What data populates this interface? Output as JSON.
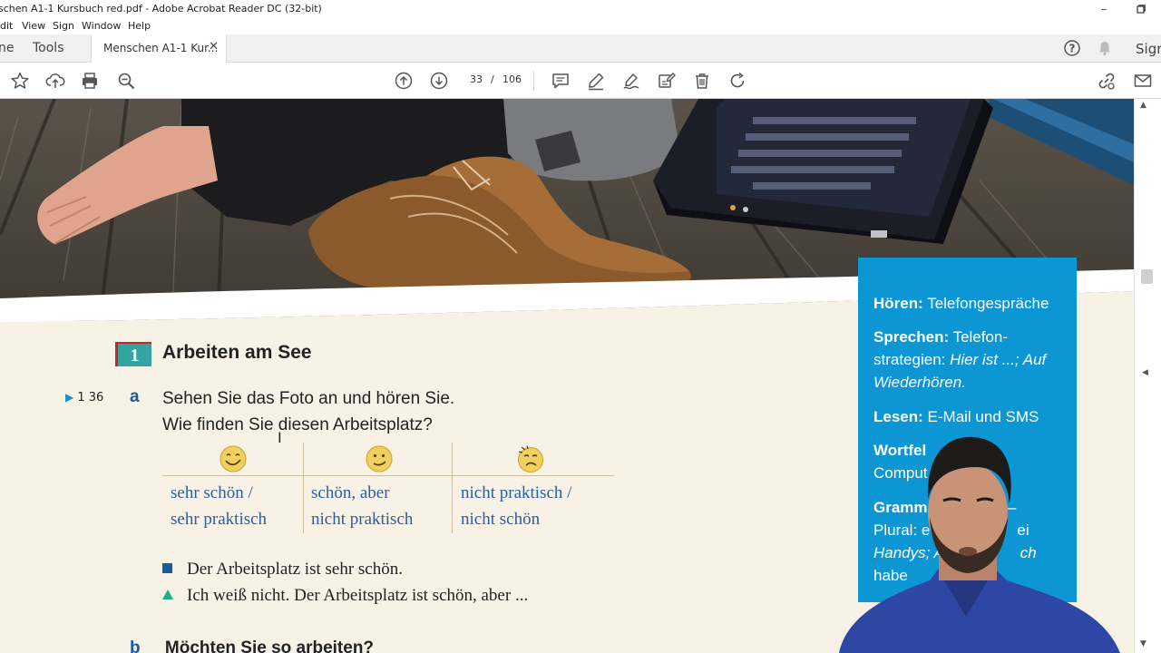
{
  "window": {
    "title": "schen A1-1 Kursbuch red.pdf - Adobe Acrobat Reader DC (32-bit)",
    "minimize_glyph": "–",
    "restore_glyph": "❐"
  },
  "menu": {
    "items": [
      "dit",
      "View",
      "Sign",
      "Window",
      "Help"
    ]
  },
  "tabs": {
    "home_label": "ne",
    "tools_label": "Tools",
    "doc_tab_label": "Menschen A1-1 Kur...",
    "close_glyph": "✕",
    "sign_label": "Sigr"
  },
  "toolbar": {
    "current_page": "33",
    "page_separator": "/",
    "total_pages": "106"
  },
  "exercise": {
    "number": "1",
    "title": "Arbeiten am See",
    "audio_track": "1 36",
    "sub_a": "a",
    "instruction_line1": "Sehen Sie das Foto an und hören Sie.",
    "instruction_line2": "Wie finden Sie diesen Arbeitsplatz?",
    "options": [
      {
        "line1": "sehr schön /",
        "line2": "sehr praktisch"
      },
      {
        "line1": "schön, aber",
        "line2": "nicht praktisch"
      },
      {
        "line1": "nicht praktisch /",
        "line2": "nicht schön"
      }
    ],
    "example1": "Der Arbeitsplatz ist sehr schön.",
    "example2": "Ich weiß nicht. Der Arbeitsplatz ist schön, aber ...",
    "next_sub": "b",
    "next_instruction": "Möchten Sie so arbeiten?"
  },
  "sidebar": {
    "hoeren_label": "Hören:",
    "hoeren_text": "Telefongespräche",
    "sprechen_label": "Sprechen:",
    "sprechen_text1": "Telefon-",
    "sprechen_text2": "strategien:",
    "sprechen_italic1": "Hier ist ...; Auf",
    "sprechen_italic2": "Wiederhören.",
    "lesen_label": "Lesen:",
    "lesen_text": "E-Mail und SMS",
    "wortfeld_label": "Wortfel",
    "wortfeld_text": "Comput",
    "grammatik_label": "Gramm",
    "grammatik_tail": "r –",
    "grammatik_line2a": "Plural: e",
    "grammatik_line2b": "ei",
    "grammatik_line3a": "Handys; A",
    "grammatik_line3b": "ch",
    "grammatik_line4": "habe"
  },
  "colors": {
    "accent_blue": "#0d96d4",
    "teal": "#35a3a0",
    "option_blue": "#2a5e9c",
    "paper": "#f7f1e6"
  }
}
